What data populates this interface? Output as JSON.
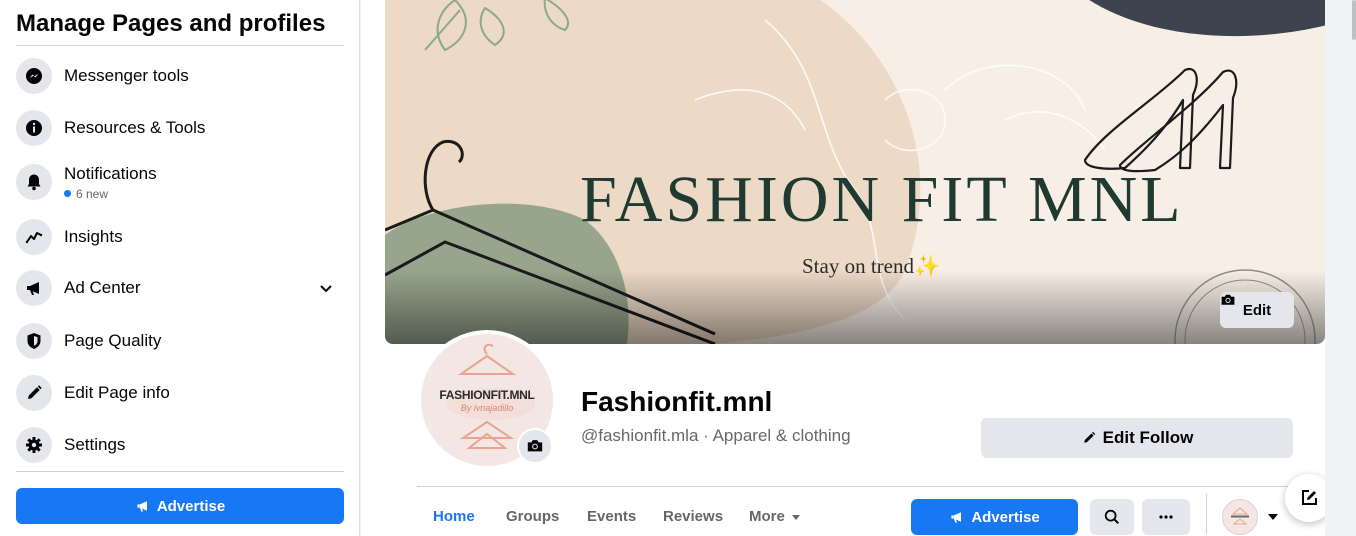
{
  "sidebar": {
    "title": "Manage Pages and profiles",
    "items": [
      {
        "label": "Messenger tools",
        "icon": "messenger-icon"
      },
      {
        "label": "Resources & Tools",
        "icon": "info-icon"
      },
      {
        "label": "Notifications",
        "icon": "bell-icon",
        "sub": "6 new"
      },
      {
        "label": "Insights",
        "icon": "insights-icon"
      },
      {
        "label": "Ad Center",
        "icon": "megaphone-icon"
      },
      {
        "label": "Page Quality",
        "icon": "shield-icon"
      },
      {
        "label": "Edit Page info",
        "icon": "pencil-icon"
      },
      {
        "label": "Settings",
        "icon": "gear-icon"
      }
    ],
    "advertise_label": "Advertise"
  },
  "cover": {
    "title": "FASHION FIT MNL",
    "subtitle": "Stay on trend✨",
    "edit_label": "Edit"
  },
  "avatar": {
    "brand_text": "FASHIONFIT.MNL",
    "script_text": "By ivnajadillo"
  },
  "page": {
    "name": "Fashionfit.mnl",
    "handle": "@fashionfit.mla · Apparel & clothing",
    "edit_follow_label": "Edit Follow"
  },
  "tabs": [
    {
      "label": "Home",
      "active": true
    },
    {
      "label": "Groups"
    },
    {
      "label": "Events"
    },
    {
      "label": "Reviews"
    },
    {
      "label": "More"
    }
  ],
  "actions": {
    "advertise_label": "Advertise"
  },
  "colors": {
    "accent": "#1877f2",
    "cover_green": "#1f3a31",
    "cover_sage": "#97a58d",
    "cover_beige": "#ecd9c6"
  }
}
